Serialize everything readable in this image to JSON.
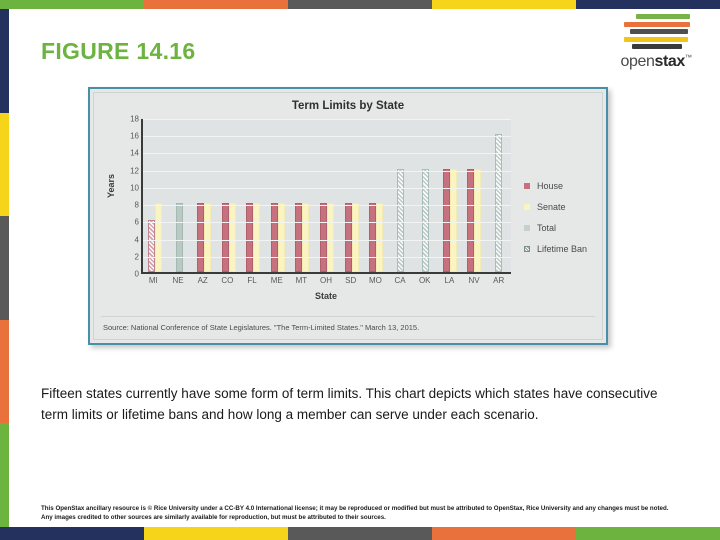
{
  "header": {
    "figure_label": "FIGURE 14.16",
    "figure_label_color": "#6cb33f",
    "logo_text_light": "open",
    "logo_text_bold": "stax",
    "logo_tm": "™"
  },
  "strips": {
    "top": [
      "#6cb33f",
      "#e8713c",
      "#595959",
      "#f5d41a",
      "#24305e"
    ],
    "bottom": [
      "#24305e",
      "#f5d41a",
      "#595959",
      "#e8713c",
      "#6cb33f"
    ],
    "left": [
      "#24305e",
      "#f5d41a",
      "#595959",
      "#e8713c",
      "#6cb33f"
    ]
  },
  "chart_data": {
    "type": "bar",
    "title": "Term Limits by State",
    "xlabel": "State",
    "ylabel": "Years",
    "ylim": [
      0,
      18
    ],
    "yticks": [
      18,
      16,
      14,
      12,
      10,
      8,
      6,
      4,
      2,
      0
    ],
    "grid": true,
    "legend_position": "right",
    "source": "Source: National Conference of State Legislatures. \"The Term-Limited States.\" March 13, 2015.",
    "categories": [
      "MI",
      "NE",
      "AZ",
      "CO",
      "FL",
      "ME",
      "MT",
      "OH",
      "SD",
      "MO",
      "CA",
      "OK",
      "LA",
      "NV",
      "AR"
    ],
    "legend": [
      {
        "name": "House",
        "color": "#c8717e",
        "swatch": "house"
      },
      {
        "name": "Senate",
        "color": "#faf3c2",
        "swatch": "senate"
      },
      {
        "name": "Total",
        "color": "#c3d0cb",
        "swatch": "total"
      },
      {
        "name": "Lifetime Ban",
        "color": "#8a9a95",
        "swatch": "ban"
      }
    ],
    "series": [
      {
        "name": "House",
        "values": [
          6,
          null,
          8,
          8,
          8,
          8,
          8,
          8,
          8,
          8,
          null,
          null,
          12,
          12,
          null
        ]
      },
      {
        "name": "Senate",
        "values": [
          8,
          null,
          8,
          8,
          8,
          8,
          8,
          8,
          8,
          8,
          null,
          null,
          12,
          12,
          null
        ]
      },
      {
        "name": "Total",
        "values": [
          null,
          8,
          null,
          null,
          null,
          null,
          null,
          null,
          null,
          null,
          12,
          12,
          null,
          null,
          16
        ]
      }
    ],
    "lifetime_ban_states": [
      "MI",
      "CA",
      "OK",
      "AR"
    ],
    "bars": [
      {
        "state": "MI",
        "items": [
          {
            "series": "House",
            "value": 6,
            "lifetime_ban": true
          },
          {
            "series": "Senate",
            "value": 8,
            "lifetime_ban": true
          }
        ]
      },
      {
        "state": "NE",
        "items": [
          {
            "series": "Total",
            "value": 8,
            "lifetime_ban": false
          }
        ]
      },
      {
        "state": "AZ",
        "items": [
          {
            "series": "House",
            "value": 8,
            "lifetime_ban": false
          },
          {
            "series": "Senate",
            "value": 8,
            "lifetime_ban": false
          }
        ]
      },
      {
        "state": "CO",
        "items": [
          {
            "series": "House",
            "value": 8,
            "lifetime_ban": false
          },
          {
            "series": "Senate",
            "value": 8,
            "lifetime_ban": false
          }
        ]
      },
      {
        "state": "FL",
        "items": [
          {
            "series": "House",
            "value": 8,
            "lifetime_ban": false
          },
          {
            "series": "Senate",
            "value": 8,
            "lifetime_ban": false
          }
        ]
      },
      {
        "state": "ME",
        "items": [
          {
            "series": "House",
            "value": 8,
            "lifetime_ban": false
          },
          {
            "series": "Senate",
            "value": 8,
            "lifetime_ban": false
          }
        ]
      },
      {
        "state": "MT",
        "items": [
          {
            "series": "House",
            "value": 8,
            "lifetime_ban": false
          },
          {
            "series": "Senate",
            "value": 8,
            "lifetime_ban": false
          }
        ]
      },
      {
        "state": "OH",
        "items": [
          {
            "series": "House",
            "value": 8,
            "lifetime_ban": false
          },
          {
            "series": "Senate",
            "value": 8,
            "lifetime_ban": false
          }
        ]
      },
      {
        "state": "SD",
        "items": [
          {
            "series": "House",
            "value": 8,
            "lifetime_ban": false
          },
          {
            "series": "Senate",
            "value": 8,
            "lifetime_ban": false
          }
        ]
      },
      {
        "state": "MO",
        "items": [
          {
            "series": "House",
            "value": 8,
            "lifetime_ban": false
          },
          {
            "series": "Senate",
            "value": 8,
            "lifetime_ban": false
          }
        ]
      },
      {
        "state": "CA",
        "items": [
          {
            "series": "Total",
            "value": 12,
            "lifetime_ban": true
          }
        ]
      },
      {
        "state": "OK",
        "items": [
          {
            "series": "Total",
            "value": 12,
            "lifetime_ban": true
          }
        ]
      },
      {
        "state": "LA",
        "items": [
          {
            "series": "House",
            "value": 12,
            "lifetime_ban": false
          },
          {
            "series": "Senate",
            "value": 12,
            "lifetime_ban": false
          }
        ]
      },
      {
        "state": "NV",
        "items": [
          {
            "series": "House",
            "value": 12,
            "lifetime_ban": false
          },
          {
            "series": "Senate",
            "value": 12,
            "lifetime_ban": false
          }
        ]
      },
      {
        "state": "AR",
        "items": [
          {
            "series": "Total",
            "value": 16,
            "lifetime_ban": true
          }
        ]
      }
    ]
  },
  "body": {
    "paragraph": "Fifteen states currently have some form of term limits. This chart depicts which states have consecutive term limits or lifetime bans and how long a member can serve under each scenario."
  },
  "footer": {
    "text": "This OpenStax ancillary resource is © Rice University under a CC-BY 4.0 International license; it may be reproduced or modified but must be attributed to OpenStax, Rice University and any changes must be noted. Any images credited to other sources are similarly available for reproduction, but must be attributed to their sources."
  }
}
